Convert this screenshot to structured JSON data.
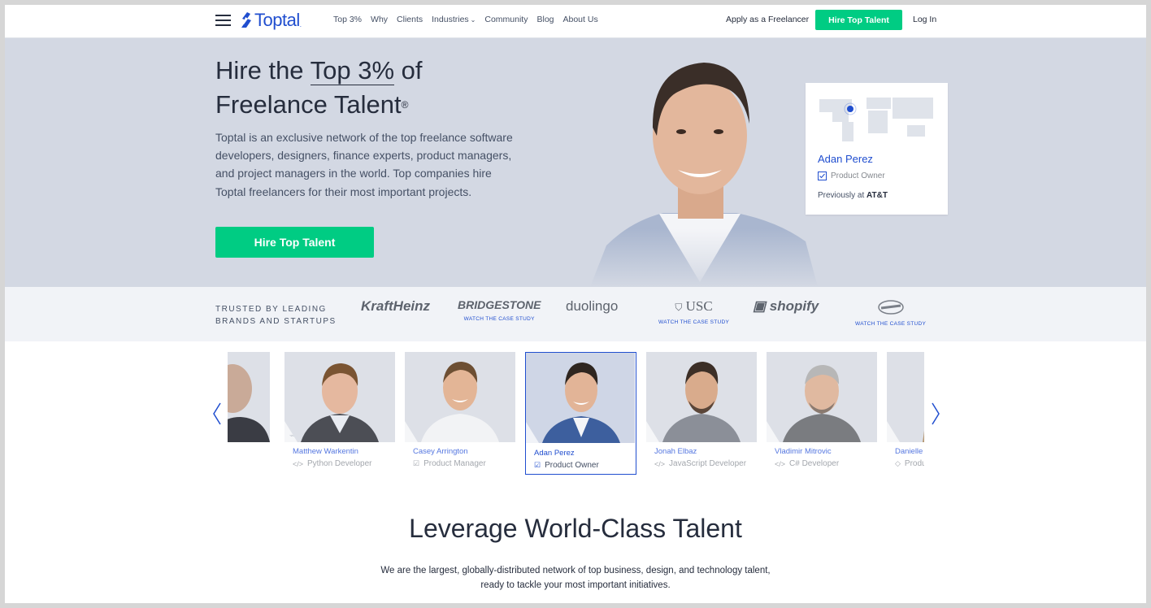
{
  "header": {
    "logo_text": "Toptal",
    "nav": [
      {
        "label": "Top 3%"
      },
      {
        "label": "Why"
      },
      {
        "label": "Clients"
      },
      {
        "label": "Industries",
        "has_dropdown": true
      },
      {
        "label": "Community"
      },
      {
        "label": "Blog"
      },
      {
        "label": "About Us"
      }
    ],
    "apply_label": "Apply as a Freelancer",
    "hire_label": "Hire Top Talent",
    "login_label": "Log In"
  },
  "hero": {
    "title_pre": "Hire the ",
    "title_highlight": "Top 3%",
    "title_post": " of",
    "title_line2": "Freelance Talent",
    "title_mark": "®",
    "description": "Toptal is an exclusive network of the top freelance software developers, designers, finance experts, product managers, and project managers in the world. Top companies hire Toptal freelancers for their most important projects.",
    "cta_label": "Hire Top Talent",
    "profile": {
      "name": "Adan Perez",
      "role": "Product Owner",
      "previously_label": "Previously at ",
      "previously_company": "AT&T"
    }
  },
  "trusted": {
    "label": "TRUSTED BY LEADING BRANDS AND STARTUPS",
    "brands": [
      {
        "name": "KraftHeinz",
        "case": ""
      },
      {
        "name": "BRIDGESTONE",
        "case": "WATCH THE CASE STUDY"
      },
      {
        "name": "duolingo",
        "case": ""
      },
      {
        "name": "USC",
        "case": "WATCH THE CASE STUDY"
      },
      {
        "name": "shopify",
        "case": ""
      },
      {
        "name": "Cavaliers",
        "case": "WATCH THE CASE STUDY"
      }
    ]
  },
  "carousel": {
    "talent": [
      {
        "name": "",
        "role": ""
      },
      {
        "name": "Matthew Warkentin",
        "role": "Python Developer",
        "role_icon": "code-icon"
      },
      {
        "name": "Casey Arrington",
        "role": "Product Manager",
        "role_icon": "check-icon"
      },
      {
        "name": "Adan Perez",
        "role": "Product Owner",
        "role_icon": "check-icon",
        "active": true
      },
      {
        "name": "Jonah Elbaz",
        "role": "JavaScript Developer",
        "role_icon": "code-icon"
      },
      {
        "name": "Vladimir Mitrovic",
        "role": "C# Developer",
        "role_icon": "code-icon"
      },
      {
        "name": "Danielle T",
        "role": "Produ",
        "role_icon": "pen-icon"
      }
    ]
  },
  "section": {
    "title": "Leverage World-Class Talent",
    "description": "We are the largest, globally-distributed network of top business, design, and technology talent, ready to tackle your most important initiatives."
  },
  "colors": {
    "brand_blue": "#204ecf",
    "accent_green": "#00cc83",
    "hero_bg": "#d3d8e3",
    "text_dark": "#262d3d"
  }
}
